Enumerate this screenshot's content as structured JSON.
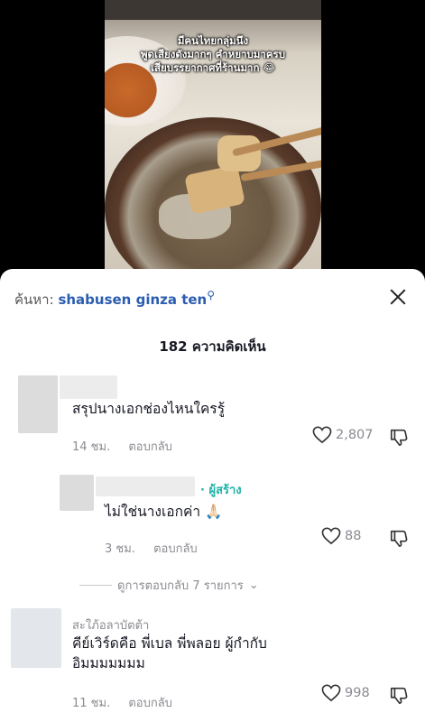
{
  "video": {
    "caption_lines": [
      "มีคนไทยกลุ่มนึง",
      "พูดเสียงดังมากๆ คำหยาบมาครบ",
      "เสียบรรยากาศที่ร้านมาก 😂"
    ]
  },
  "sheet": {
    "search_prefix": "ค้นหา:",
    "search_term": "shabusen ginza ten",
    "comment_count": "182 ความคิดเห็น"
  },
  "comments": [
    {
      "text": "สรุปนางเอกช่องไหนใครรู้",
      "time": "14 ชม.",
      "reply_label": "ตอบกลับ",
      "likes": "2,807"
    },
    {
      "creator_label": "ผู้สร้าง",
      "text": "ไม่ใช่นางเอกค่า 🙏🏻",
      "time": "3 ชม.",
      "reply_label": "ตอบกลับ",
      "likes": "88"
    },
    {
      "username": "สะใภ้อลาบัตต้า",
      "text_line1": "คีย์เวิร์ดคือ พี่เบล พี่พลอย ผู้กำกับ",
      "text_line2": "อิมมมมมมม",
      "time": "11 ชม.",
      "reply_label": "ตอบกลับ",
      "likes": "998"
    }
  ],
  "view_replies": "ดูการตอบกลับ 7 รายการ",
  "colors": {
    "link": "#2b5db0",
    "creator": "#1fb2a8",
    "muted": "#8a8b91"
  },
  "icons": [
    "search-icon",
    "close-icon",
    "heart-icon",
    "dislike-icon",
    "chevron-down-icon"
  ]
}
